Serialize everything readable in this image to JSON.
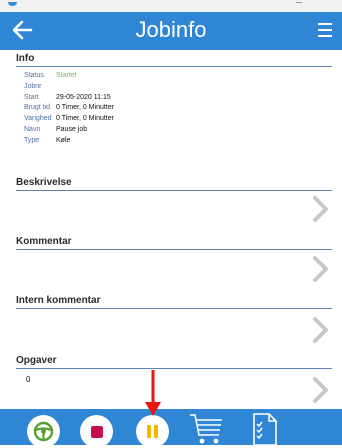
{
  "topbar": {
    "title": "Jobinfo"
  },
  "info": {
    "heading": "Info",
    "rows": [
      {
        "label": "Status",
        "value": "Startet"
      },
      {
        "label": "Jobnr",
        "value": ""
      },
      {
        "label": "Start",
        "value": "29-05-2020 11:15"
      },
      {
        "label": "Brugt tid",
        "value": "0 Timer, 0 Minutter"
      },
      {
        "label": "Varighed",
        "value": "0 Timer, 0 Minutter"
      },
      {
        "label": "Navn",
        "value": "Pause job"
      },
      {
        "label": "Type",
        "value": "Køle"
      }
    ]
  },
  "sections": {
    "beskrivelse": "Beskrivelse",
    "kommentar": "Kommentar",
    "intern": "Intern kommentar",
    "opgaver": "Opgaver",
    "opgaver_value": "0"
  },
  "colors": {
    "accent": "#2f86d4",
    "status_green": "#74b84a",
    "drive_green": "#57a030",
    "stop_red": "#c1124f",
    "pause_yellow": "#f3b700",
    "annotation_red": "#e8160f"
  },
  "icons": [
    "back-arrow-icon",
    "menu-icon",
    "chevron-right-icon",
    "steering-wheel-icon",
    "stop-icon",
    "pause-icon",
    "cart-icon",
    "checklist-icon"
  ]
}
